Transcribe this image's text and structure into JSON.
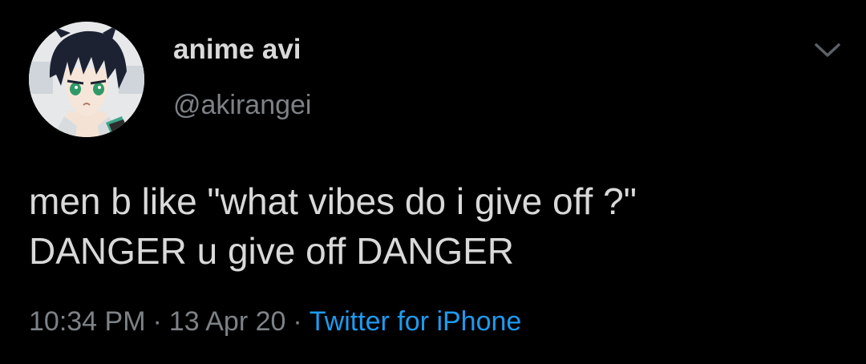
{
  "colors": {
    "background": "#000000",
    "primary_text": "#d9d9d9",
    "secondary_text": "#7d8287",
    "link": "#1d9bf0"
  },
  "author": {
    "display_name": "anime avi",
    "handle": "@akirangei",
    "avatar_icon": "anime-character-avatar"
  },
  "menu": {
    "icon": "chevron-down-icon"
  },
  "tweet": {
    "lines": [
      "men b like \"what vibes do i give off ?\"",
      "DANGER u give off DANGER"
    ]
  },
  "meta": {
    "time": "10:34 PM",
    "separator": "·",
    "date": "13 Apr 20",
    "source": "Twitter for iPhone"
  }
}
